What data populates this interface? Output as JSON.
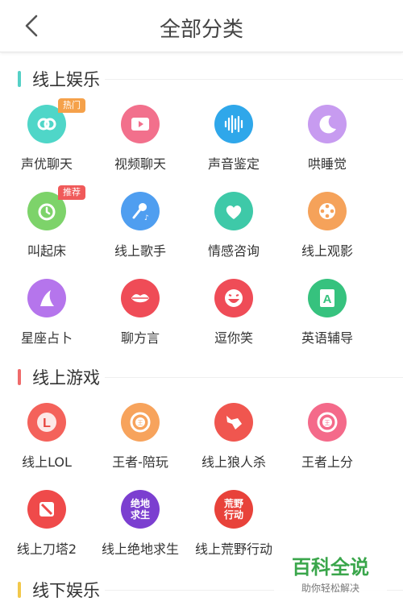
{
  "header": {
    "title": "全部分类"
  },
  "sections": [
    {
      "title": "线上娱乐",
      "color": "#55d0c6",
      "items": [
        {
          "label": "声优聊天",
          "icon": "voice-chat-icon",
          "badge": "热门"
        },
        {
          "label": "视频聊天",
          "icon": "video-chat-icon"
        },
        {
          "label": "声音鉴定",
          "icon": "sound-wave-icon"
        },
        {
          "label": "哄睡觉",
          "icon": "moon-icon"
        },
        {
          "label": "叫起床",
          "icon": "alarm-clock-icon",
          "badge": "推荐"
        },
        {
          "label": "线上歌手",
          "icon": "microphone-icon"
        },
        {
          "label": "情感咨询",
          "icon": "heart-chat-icon"
        },
        {
          "label": "线上观影",
          "icon": "film-reel-icon"
        },
        {
          "label": "星座占卜",
          "icon": "witch-hat-icon"
        },
        {
          "label": "聊方言",
          "icon": "lips-icon"
        },
        {
          "label": "逗你笑",
          "icon": "laughing-face-icon"
        },
        {
          "label": "英语辅导",
          "icon": "letter-a-book-icon"
        }
      ]
    },
    {
      "title": "线上游戏",
      "color": "#ef6b6b",
      "items": [
        {
          "label": "线上LOL",
          "icon": "lol-logo-icon"
        },
        {
          "label": "王者-陪玩",
          "icon": "king-glory-icon"
        },
        {
          "label": "线上狼人杀",
          "icon": "wolf-icon"
        },
        {
          "label": "王者上分",
          "icon": "king-rank-icon"
        },
        {
          "label": "线上刀塔2",
          "icon": "dota2-logo-icon"
        },
        {
          "label": "线上绝地求生",
          "icon": "pubg-logo-icon",
          "logo_text": "绝地求生"
        },
        {
          "label": "线上荒野行动",
          "icon": "knives-out-logo-icon",
          "logo_text": "荒野行动"
        }
      ]
    },
    {
      "title": "线下娱乐",
      "color": "#f2c84b",
      "items": []
    }
  ],
  "watermark": {
    "title": "百科全说",
    "subtitle": "助你轻松解决"
  }
}
